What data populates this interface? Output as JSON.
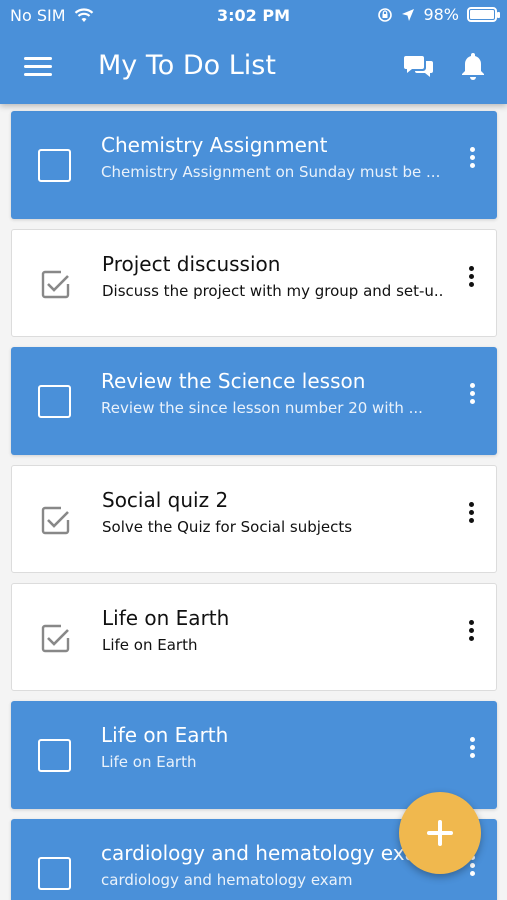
{
  "status_bar": {
    "carrier": "No SIM",
    "time": "3:02 PM",
    "battery": "98%",
    "battery_level": 0.98
  },
  "header": {
    "title": "My To Do List",
    "menu_icon": "hamburger-menu-icon",
    "chat_icon": "chat-bubbles-icon",
    "bell_icon": "bell-icon"
  },
  "todos": [
    {
      "title": "Chemistry Assignment",
      "desc": "Chemistry Assignment on Sunday must be ...",
      "checked": false,
      "highlighted": true
    },
    {
      "title": "Project discussion",
      "desc": "Discuss the project with my group and set-u...",
      "checked": true,
      "highlighted": false
    },
    {
      "title": "Review the Science lesson",
      "desc": "Review the since lesson number 20 with ...",
      "checked": false,
      "highlighted": true
    },
    {
      "title": "Social quiz 2",
      "desc": "Solve the Quiz for Social subjects",
      "checked": true,
      "highlighted": false
    },
    {
      "title": "Life on Earth",
      "desc": "Life on Earth",
      "checked": true,
      "highlighted": false
    },
    {
      "title": "Life on Earth",
      "desc": "Life on Earth",
      "checked": false,
      "highlighted": true
    },
    {
      "title": "cardiology and hematology exam",
      "desc": "cardiology and hematology exam",
      "checked": false,
      "highlighted": true
    }
  ],
  "fab": {
    "icon": "plus-icon"
  },
  "colors": {
    "primary": "#4a90d9",
    "accent": "#f0b84e"
  }
}
